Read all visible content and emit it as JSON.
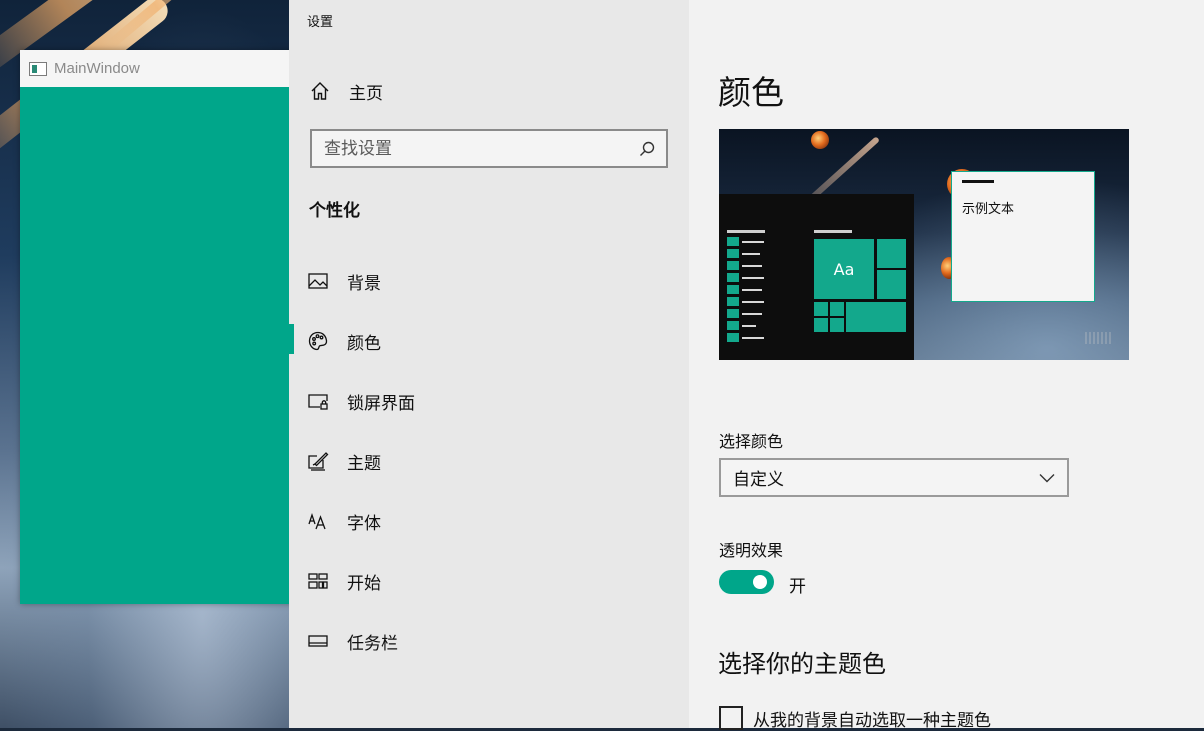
{
  "main_window": {
    "title": "MainWindow"
  },
  "settings": {
    "app_title": "设置",
    "home_label": "主页",
    "search_placeholder": "查找设置",
    "section": "个性化",
    "nav_items": [
      {
        "label": "背景",
        "icon": "picture-icon"
      },
      {
        "label": "颜色",
        "icon": "palette-icon"
      },
      {
        "label": "锁屏界面",
        "icon": "lock-screen-icon"
      },
      {
        "label": "主题",
        "icon": "theme-icon"
      },
      {
        "label": "字体",
        "icon": "font-icon"
      },
      {
        "label": "开始",
        "icon": "start-icon"
      },
      {
        "label": "任务栏",
        "icon": "taskbar-icon"
      }
    ],
    "selected_item": "颜色"
  },
  "content": {
    "title": "颜色",
    "preview": {
      "tile_text": "Aa",
      "sample_text": "示例文本"
    },
    "choose_color_label": "选择颜色",
    "choose_color_value": "自定义",
    "transparency_label": "透明效果",
    "transparency_state": "开",
    "transparency_on": true,
    "accent_heading": "选择你的主题色",
    "auto_pick_label": "从我的背景自动选取一种主题色",
    "auto_pick_checked": false
  },
  "colors": {
    "accent": "#00a68a",
    "nav_background": "#e8e8e8",
    "content_background": "#f2f2f2"
  }
}
